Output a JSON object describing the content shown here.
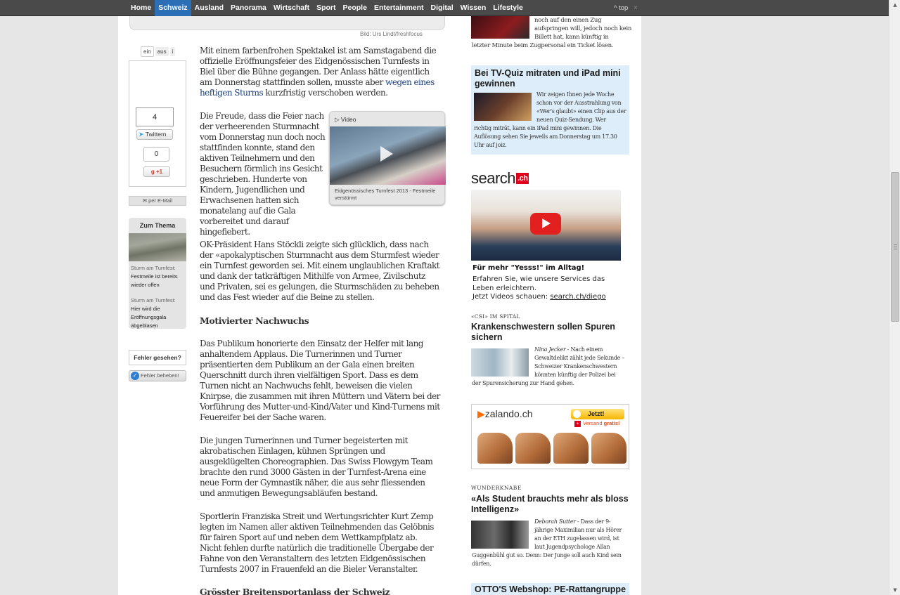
{
  "nav": {
    "items": [
      "Home",
      "Schweiz",
      "Ausland",
      "Panorama",
      "Wirtschaft",
      "Sport",
      "People",
      "Entertainment",
      "Digital",
      "Wissen",
      "Lifestyle"
    ],
    "active": "Schweiz",
    "top_link": "^ top",
    "close": "×"
  },
  "image_credit": "Bild: Urs Lindt/freshfocus",
  "share": {
    "toggle_on": "ein",
    "toggle_off": "aus",
    "toggle_info": "i",
    "tweet_count": "4",
    "tweet_label": "Twittern",
    "gplus_count": "0",
    "gplus_label": "+1",
    "email_label": "per E-Mail"
  },
  "zum_thema": {
    "title": "Zum Thema",
    "links": [
      {
        "pre": "Sturm am Turnfest:",
        "text": "Festmeile ist bereits wieder offen"
      },
      {
        "pre": "Sturm am Turnfest:",
        "text": "Hier wird die Eröffnungsgala abgeblasen"
      }
    ]
  },
  "fehler": {
    "question": "Fehler gesehen?",
    "button": "Fehler beheben!"
  },
  "video": {
    "label": "Video",
    "caption": "Eidgenössisches Turnfest 2013 - Festmeile verstürmt"
  },
  "article": {
    "p1_a": "Mit einem farbenfrohen Spektakel ist am Samstagabend die offizielle Eröffnungsfeier des Eidgenössischen Turnfests in Biel über die Bühne gegangen. Der Anlass hätte eigentlich am Donnerstag stattfinden sollen, musste aber ",
    "p1_link": "wegen eines heftigen Sturms",
    "p1_b": " kurzfristig verschoben werden.",
    "p2": "Die Freude, dass die Feier nach der verheerenden Sturmnacht vom Donnerstag nun doch noch stattfinden konnte, stand den aktiven Teilnehmern und den Besuchern förmlich ins Gesicht geschrieben. Hunderte von Kindern, Jugendlichen und Erwachsenen hatten sich monatelang auf die Gala vorbereitet und darauf hingefiebert.",
    "p3": "OK-Präsident Hans Stöckli zeigte sich glücklich, dass nach der «apokalyptischen Sturmnacht aus dem Sturmfest wieder ein Turnfest geworden sei. Mit einem unglaublichen Kraftakt und dank der tatkräftigen Mithilfe von Armee, Zivilschutz und Privaten, sei es gelungen, die Sturmschäden zu beheben und das Fest wieder auf die Beine zu stellen.",
    "subhead1": "Motivierter Nachwuchs",
    "p4": "Das Publikum honorierte den Einsatz der Helfer mit lang anhaltendem Applaus. Die Turnerinnen und Turner präsentierten dem Publikum an der Gala einen breiten Querschnitt durch ihren vielfältigen Sport. Dass es dem Turnen nicht an Nachwuchs fehlt, beweisen die vielen Knirpse, die zusammen mit ihren Müttern und Vätern bei der Vorführung des Mutter-und-Kind/Vater und Kind-Turnens mit Feuereifer bei der Sache waren.",
    "p5": "Die jungen Turnerinnen und Turner begeisterten mit akrobatischen Einlagen, kühnen Sprüngen und ausgeklügelten Choreographien. Das Swiss Flowgym Team brachte den rund 3000 Gästen in der Turnfest-Arena eine neue Form der Gymnastik näher, die aus sehr fliessenden und anmutigen Bewegungsabläufen bestand.",
    "p6": "Sportlerin Franziska Streit und Wertungsrichter Kurt Zemp legten im Namen aller aktiven Teilnehmenden das Gelöbnis für fairen Sport auf und neben dem Wettkampfplatz ab. Nicht fehlen durfte natürlich die traditionelle Übergabe der Fahne von den Veranstaltern des letzten Eidgenössischen Turnfests 2007 in Frauenfeld an die Bieler Veranstalter.",
    "subhead2": "Grösster Breitensportanlass der Schweiz"
  },
  "sidebar": {
    "top_teaser_text": "noch auf den einen Zug aufspringen will, jedoch noch kein Billett hat, kann künftig in",
    "top_teaser_tail": "letzter Minute beim Zugpersonal ein Ticket lösen.",
    "tvquiz": {
      "title": "Bei TV-Quiz mitraten und iPad mini gewinnen",
      "text": "Wir zeigen Ihnen jede Woche schon vor der Ausstrahlung von «Wer's glaubt» einen Clip aus der neuen Quiz-Sendung. Wer",
      "tail": "richtig miträt, kann ein iPad mini gewinnen. Die Auflösung sehen Sie jeweils am Donnerstag um 17.30 Uhr auf joiz."
    },
    "search_ad": {
      "logo_word": "search",
      "logo_suffix": ".ch",
      "line1": "Für mehr \"Yesss!\" im Alltag!",
      "line2": "Erfahren Sie, wie unsere Services das Leben erleichtern.",
      "line3_pre": "Jetzt Videos schauen: ",
      "line3_link": "search.ch/diego"
    },
    "csi": {
      "kicker": "«CSI» IM SPITAL",
      "title": "Krankenschwestern sollen Spuren sichern",
      "author": "Nina Jecker",
      "text": " - Nach einem Gewaltdelikt zählt jede Sekunde – Schweizer Krankenschwestern könnten künftig der Polizei bei",
      "tail": "der Spurensicherung zur Hand gehen."
    },
    "zalando": {
      "logo": "zalando.ch",
      "cta": "Jetzt!",
      "shipping_pre": "Versand ",
      "shipping_strong": "gratis!"
    },
    "wunder": {
      "kicker": "WUNDERKNABE",
      "title": "«Als Student brauchts mehr als bloss Intelligenz»",
      "author": "Deborah Sutter",
      "text": " - Dass der 9-jährige Maximilian nur als Hörer an der ETH zugelassen wird, ist laut Jugendpsychologe Allan",
      "tail": "Guggenbühl gut so. Denn: Der Junge soll auch Kind sein dürfen."
    },
    "otto": "OTTO'S Webshop: PE-Rattangruppe"
  }
}
